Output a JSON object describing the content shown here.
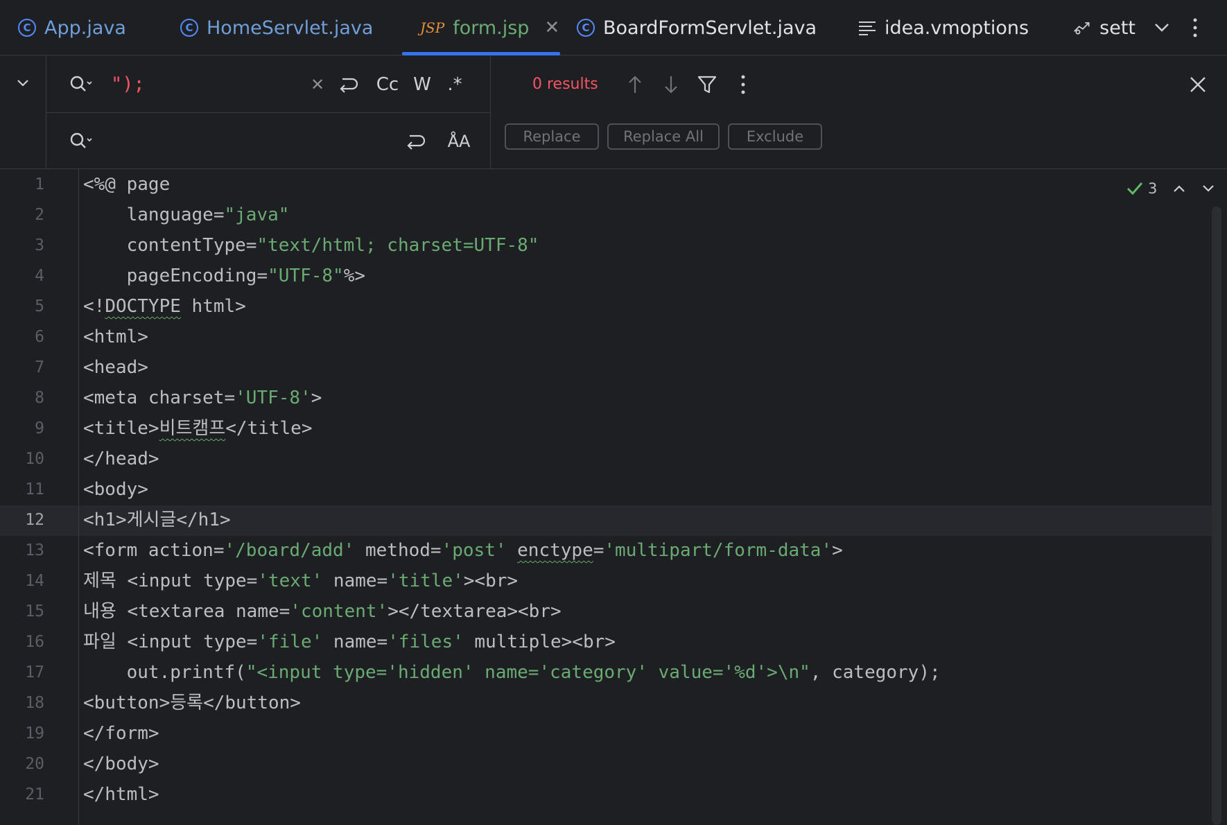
{
  "tabs": [
    {
      "label": "App.java",
      "icon": "c-class-icon"
    },
    {
      "label": "HomeServlet.java",
      "icon": "c-class-icon"
    },
    {
      "label": "form.jsp",
      "icon": "jsp-file-icon",
      "active": true
    },
    {
      "label": "BoardFormServlet.java",
      "icon": "c-class-icon"
    },
    {
      "label": "idea.vmoptions",
      "icon": "text-file-icon"
    },
    {
      "label": "sett",
      "icon": "settings-file-icon"
    }
  ],
  "jsp_icon_text": "JSP",
  "find": {
    "search_value": "\");",
    "results": "0 results",
    "option_case": "Cc",
    "option_words": "W",
    "option_regex": ".*"
  },
  "replace": {
    "value": "",
    "replace_label": "Replace",
    "replace_all_label": "Replace All",
    "exclude_label": "Exclude"
  },
  "inspection": {
    "count": "3"
  },
  "editor": {
    "current_line": 12,
    "lines": [
      {
        "n": "1",
        "code": "<%@ page"
      },
      {
        "n": "2",
        "code": "    language=\"java\""
      },
      {
        "n": "3",
        "code": "    contentType=\"text/html; charset=UTF-8\""
      },
      {
        "n": "4",
        "code": "    pageEncoding=\"UTF-8\"%>"
      },
      {
        "n": "5",
        "code": "<!DOCTYPE html>"
      },
      {
        "n": "6",
        "code": "<html>"
      },
      {
        "n": "7",
        "code": "<head>"
      },
      {
        "n": "8",
        "code": "<meta charset='UTF-8'>"
      },
      {
        "n": "9",
        "code": "<title>비트캠프</title>"
      },
      {
        "n": "10",
        "code": "</head>"
      },
      {
        "n": "11",
        "code": "<body>"
      },
      {
        "n": "12",
        "code": "<h1>게시글</h1>"
      },
      {
        "n": "13",
        "code": "<form action='/board/add' method='post' enctype='multipart/form-data'>"
      },
      {
        "n": "14",
        "code": "제목 <input type='text' name='title'><br>"
      },
      {
        "n": "15",
        "code": "내용 <textarea name='content'></textarea><br>"
      },
      {
        "n": "16",
        "code": "파일 <input type='file' name='files' multiple><br>"
      },
      {
        "n": "17",
        "code": "    out.printf(\"<input type='hidden' name='category' value='%d'>\\n\", category);"
      },
      {
        "n": "18",
        "code": "<button>등록</button>"
      },
      {
        "n": "19",
        "code": "</form>"
      },
      {
        "n": "20",
        "code": "</body>"
      },
      {
        "n": "21",
        "code": "</html>"
      }
    ]
  },
  "colors": {
    "background": "#1e1f22",
    "string": "#6aab73",
    "error": "#f75464",
    "accent": "#3574f0"
  }
}
